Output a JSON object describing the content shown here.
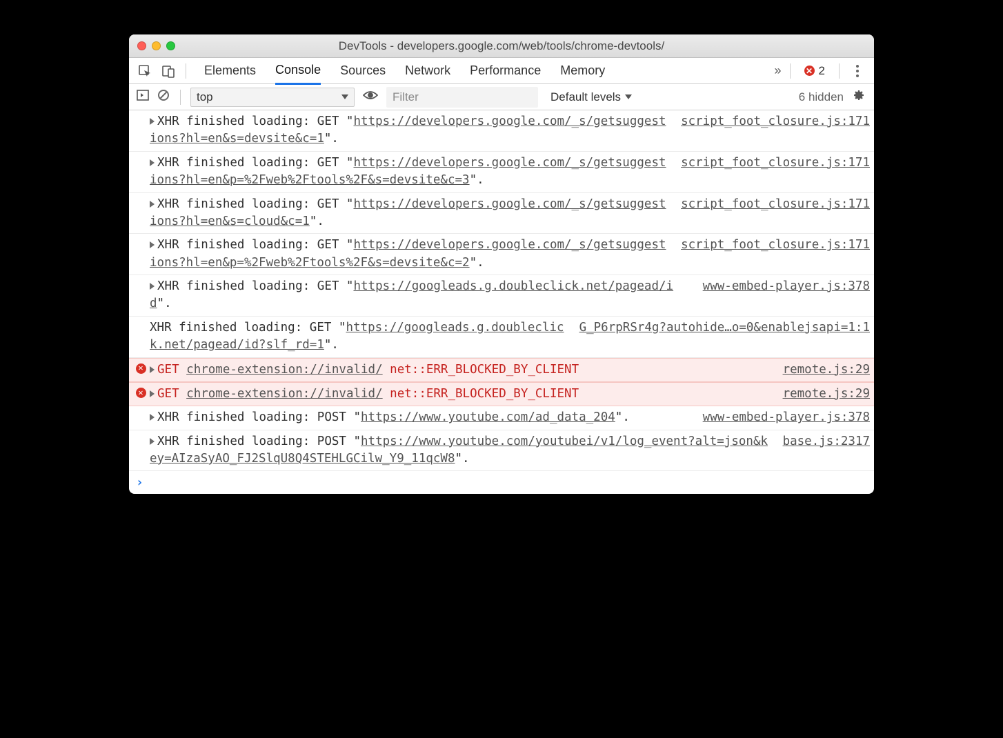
{
  "window": {
    "title": "DevTools - developers.google.com/web/tools/chrome-devtools/"
  },
  "tabs": {
    "items": [
      "Elements",
      "Console",
      "Sources",
      "Network",
      "Performance",
      "Memory"
    ],
    "active": "Console",
    "overflow_glyph": "»",
    "error_count": "2"
  },
  "toolbar": {
    "context": "top",
    "filter_placeholder": "Filter",
    "levels_label": "Default levels",
    "hidden_label": "6 hidden"
  },
  "messages": [
    {
      "type": "log",
      "disclosure": true,
      "prefix": "XHR finished loading: GET \"",
      "url": "https://developers.google.com/_s/getsuggestions?hl=en&s=devsite&c=1",
      "suffix": "\".",
      "source": "script_foot_closure.js:171"
    },
    {
      "type": "log",
      "disclosure": true,
      "prefix": "XHR finished loading: GET \"",
      "url": "https://developers.google.com/_s/getsuggestions?hl=en&p=%2Fweb%2Ftools%2F&s=devsite&c=3",
      "suffix": "\".",
      "source": "script_foot_closure.js:171"
    },
    {
      "type": "log",
      "disclosure": true,
      "prefix": "XHR finished loading: GET \"",
      "url": "https://developers.google.com/_s/getsuggestions?hl=en&s=cloud&c=1",
      "suffix": "\".",
      "source": "script_foot_closure.js:171"
    },
    {
      "type": "log",
      "disclosure": true,
      "prefix": "XHR finished loading: GET \"",
      "url": "https://developers.google.com/_s/getsuggestions?hl=en&p=%2Fweb%2Ftools%2F&s=devsite&c=2",
      "suffix": "\".",
      "source": "script_foot_closure.js:171"
    },
    {
      "type": "log",
      "disclosure": true,
      "prefix": "XHR finished loading: GET \"",
      "url": "https://googleads.g.doubleclick.net/pagead/id",
      "suffix": "\".",
      "source": "www-embed-player.js:378"
    },
    {
      "type": "log",
      "disclosure": false,
      "prefix": "XHR finished loading: GET \"",
      "url": "https://googleads.g.doubleclick.net/pagead/id?slf_rd=1",
      "suffix": "\".",
      "source": "G_P6rpRSr4g?autohide…o=0&enablejsapi=1:1"
    },
    {
      "type": "error",
      "disclosure": true,
      "method": "GET",
      "url": "chrome-extension://invalid/",
      "err": "net::ERR_BLOCKED_BY_CLIENT",
      "source": "remote.js:29"
    },
    {
      "type": "error",
      "disclosure": true,
      "method": "GET",
      "url": "chrome-extension://invalid/",
      "err": "net::ERR_BLOCKED_BY_CLIENT",
      "source": "remote.js:29"
    },
    {
      "type": "log",
      "disclosure": true,
      "prefix": "XHR finished loading: POST \"",
      "url": "https://www.youtube.com/ad_data_204",
      "suffix": "\".",
      "source": "www-embed-player.js:378"
    },
    {
      "type": "log",
      "disclosure": true,
      "prefix": "XHR finished loading: POST \"",
      "url": "https://www.youtube.com/youtubei/v1/log_event?alt=json&key=AIzaSyAO_FJ2SlqU8Q4STEHLGCilw_Y9_11qcW8",
      "suffix": "\".",
      "source": "base.js:2317"
    }
  ]
}
